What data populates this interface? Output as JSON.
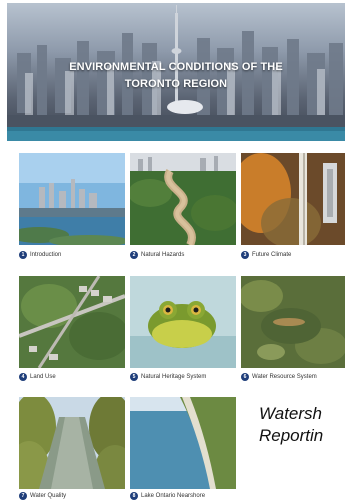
{
  "hero": {
    "title_line1": "ENVIRONMENTAL CONDITIONS OF THE",
    "title_line2": "TORONTO REGION"
  },
  "sections": [
    {
      "number": "1",
      "label": "Introduction"
    },
    {
      "number": "2",
      "label": "Natural Hazards"
    },
    {
      "number": "3",
      "label": "Future Climate"
    },
    {
      "number": "4",
      "label": "Land Use"
    },
    {
      "number": "5",
      "label": "Natural Heritage System"
    },
    {
      "number": "6",
      "label": "Water Resource System"
    },
    {
      "number": "7",
      "label": "Water Quality"
    },
    {
      "number": "8",
      "label": "Lake Ontario Nearshore"
    }
  ],
  "side_text": {
    "line1": "Watersh",
    "line2": "Reportin"
  },
  "colors": {
    "badge": "#1f3e7a"
  }
}
